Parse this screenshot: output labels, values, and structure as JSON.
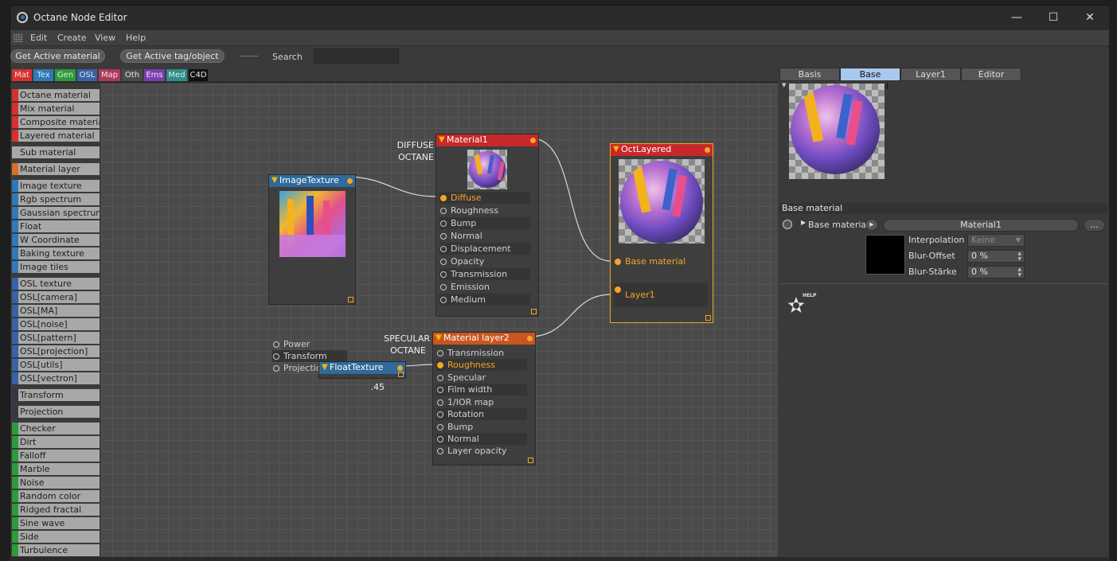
{
  "window": {
    "title": "Octane Node Editor",
    "minimize": "—",
    "maximize": "☐",
    "close": "✕"
  },
  "menu": [
    "Edit",
    "Create",
    "View",
    "Help"
  ],
  "toolbar": {
    "get_material": "Get Active material",
    "get_tag": "Get Active tag/object",
    "search_label": "Search",
    "search_value": ""
  },
  "category_tabs": [
    {
      "label": "Mat",
      "color": "#d8302f"
    },
    {
      "label": "Tex",
      "color": "#2f79b8"
    },
    {
      "label": "Gen",
      "color": "#2a9c3a"
    },
    {
      "label": "OSL",
      "color": "#3762a8"
    },
    {
      "label": "Map",
      "color": "#b0385a"
    },
    {
      "label": "Oth",
      "color": "#4a4a4a"
    },
    {
      "label": "Ems",
      "color": "#7b3db0"
    },
    {
      "label": "Med",
      "color": "#2a8f8a"
    },
    {
      "label": "C4D",
      "color": "#101010"
    }
  ],
  "sidebar": [
    {
      "label": "Octane material",
      "color": "#d8302f"
    },
    {
      "label": "Mix material",
      "color": "#d8302f"
    },
    {
      "label": "Composite material",
      "color": "#d8302f"
    },
    {
      "label": "Layered material",
      "color": "#d8302f"
    },
    {
      "label": "Sub material",
      "color": "#a8a8a8"
    },
    {
      "label": "Material layer",
      "color": "#d8702a"
    },
    {
      "label": "Image texture",
      "color": "#2f79b8"
    },
    {
      "label": "Rgb spectrum",
      "color": "#2f79b8"
    },
    {
      "label": "Gaussian spectrum",
      "color": "#2f79b8"
    },
    {
      "label": "Float",
      "color": "#2f79b8"
    },
    {
      "label": "W Coordinate",
      "color": "#2f79b8"
    },
    {
      "label": "Baking texture",
      "color": "#2f79b8"
    },
    {
      "label": "Image tiles",
      "color": "#2f79b8"
    },
    {
      "label": "OSL texture",
      "color": "#3762a8"
    },
    {
      "label": "OSL[camera]",
      "color": "#3762a8"
    },
    {
      "label": "OSL[MA]",
      "color": "#3762a8"
    },
    {
      "label": "OSL[noise]",
      "color": "#3762a8"
    },
    {
      "label": "OSL[pattern]",
      "color": "#3762a8"
    },
    {
      "label": "OSL[projection]",
      "color": "#3762a8"
    },
    {
      "label": "OSL[utils]",
      "color": "#3762a8"
    },
    {
      "label": "OSL[vectron]",
      "color": "#3762a8"
    },
    {
      "label": "Transform",
      "color": "#353545"
    },
    {
      "label": "Projection",
      "color": "#353545"
    },
    {
      "label": "Checker",
      "color": "#2a9c3a"
    },
    {
      "label": "Dirt",
      "color": "#2a9c3a"
    },
    {
      "label": "Falloff",
      "color": "#2a9c3a"
    },
    {
      "label": "Marble",
      "color": "#2a9c3a"
    },
    {
      "label": "Noise",
      "color": "#2a9c3a"
    },
    {
      "label": "Random color",
      "color": "#2a9c3a"
    },
    {
      "label": "Ridged fractal",
      "color": "#2a9c3a"
    },
    {
      "label": "Sine wave",
      "color": "#2a9c3a"
    },
    {
      "label": "Side",
      "color": "#2a9c3a"
    },
    {
      "label": "Turbulence",
      "color": "#2a9c3a"
    }
  ],
  "nodes": {
    "image_texture": {
      "title": "ImageTexture",
      "color": "#2f6a9c",
      "ports": [
        "Power",
        "Transform",
        "Projection"
      ]
    },
    "material1": {
      "title": "Material1",
      "color": "#c8282a",
      "caption_line1": "DIFFUSE",
      "caption_line2": "OCTANE",
      "ports": [
        "Diffuse",
        "Roughness",
        "Bump",
        "Normal",
        "Displacement",
        "Opacity",
        "Transmission",
        "Emission",
        "Medium"
      ]
    },
    "oct_layered": {
      "title": "OctLayered",
      "color": "#c8282a",
      "ports": [
        "Base material",
        "Layer1"
      ]
    },
    "material_layer2": {
      "title": "Material layer2",
      "color": "#c8561e",
      "caption_line1": "SPECULAR",
      "caption_line2": "OCTANE",
      "ports": [
        "Transmission",
        "Roughness",
        "Specular",
        "Film width",
        "1/IOR map",
        "Rotation",
        "Bump",
        "Normal",
        "Layer opacity"
      ]
    },
    "float_texture": {
      "title": "FloatTexture",
      "color": "#2f6a9c",
      "value": ".45"
    }
  },
  "right_panel": {
    "tabs": [
      "Basis",
      "Base material",
      "Layer1",
      "Editor"
    ],
    "active_tab": "Base material",
    "section_title": "Base material",
    "base_material_label": "Base material",
    "base_material_value": "Material1",
    "more_button": "...",
    "interpolation_label": "Interpolation",
    "interpolation_value": "Keine",
    "blur_offset_label": "Blur-Offset",
    "blur_offset_value": "0 %",
    "blur_staerke_label": "Blur-Stärke",
    "blur_staerke_value": "0 %",
    "help_label": "HELP"
  },
  "colors": {
    "accent": "#f5a623",
    "active_tab": "#a9c8ee",
    "selection": "#f5a623"
  }
}
